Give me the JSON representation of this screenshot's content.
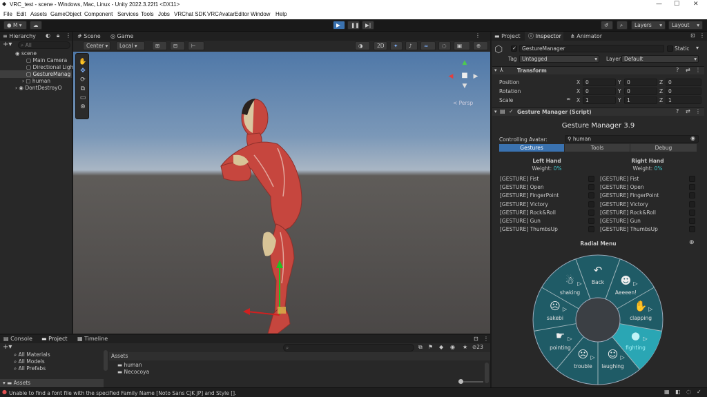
{
  "window": {
    "title": "VRC_test - scene - Windows, Mac, Linux - Unity 2022.3.22f1 <DX11>"
  },
  "menu": [
    "File",
    "Edit",
    "Assets",
    "GameObject",
    "Component",
    "Services",
    "Tools",
    "Jobs",
    "VRChat SDK",
    "VRCAvatarEditor",
    "Window",
    "Help"
  ],
  "toolbar": {
    "account": "M",
    "layers": "Layers",
    "layout": "Layout"
  },
  "hierarchy": {
    "tab": "Hierarchy",
    "search_placeholder": "All",
    "items": [
      "scene",
      "Main Camera",
      "Directional Ligh",
      "GestureManag",
      "human",
      "DontDestroyO"
    ]
  },
  "scene_view": {
    "tabs": [
      "Scene",
      "Game"
    ],
    "pivot": "Center",
    "space": "Local",
    "mode_2d": "2D",
    "persp": "< Persp"
  },
  "bottom": {
    "tabs": [
      "Console",
      "Project",
      "Timeline"
    ],
    "favorites": [
      "All Materials",
      "All Models",
      "All Prefabs"
    ],
    "assets_label": "Assets",
    "asset_root": "Assets",
    "asset_items": [
      "human",
      "Necocoya"
    ],
    "count": "23"
  },
  "status_bar": "Unable to find a font file with the specified Family Name [Noto Sans CJK JP] and Style [].",
  "inspector": {
    "tabs": [
      "Project",
      "Inspector",
      "Animator"
    ],
    "object_name": "GestureManager",
    "static": "Static",
    "tag_label": "Tag",
    "tag": "Untagged",
    "layer_label": "Layer",
    "layer": "Default",
    "transform": {
      "title": "Transform",
      "position": {
        "label": "Position",
        "x": "0",
        "y": "0",
        "z": "0"
      },
      "rotation": {
        "label": "Rotation",
        "x": "0",
        "y": "0",
        "z": "0"
      },
      "scale": {
        "label": "Scale",
        "x": "1",
        "y": "1",
        "z": "1"
      }
    },
    "script_title": "Gesture Manager (Script)",
    "gm": {
      "title": "Gesture Manager 3.9",
      "controlling_label": "Controlling Avatar:",
      "avatar": "human",
      "tabs": [
        "Gestures",
        "Tools",
        "Debug"
      ],
      "left": {
        "title": "Left Hand",
        "weight_label": "Weight:",
        "weight": "0%"
      },
      "right": {
        "title": "Right Hand",
        "weight_label": "Weight:",
        "weight": "0%"
      },
      "gestures": [
        "[GESTURE] Fist",
        "[GESTURE] Open",
        "[GESTURE] FingerPoint",
        "[GESTURE] Victory",
        "[GESTURE] Rock&Roll",
        "[GESTURE] Gun",
        "[GESTURE] ThumbsUp"
      ],
      "radial_title": "Radial Menu",
      "radial_items": [
        "Back",
        "Aeeeen!",
        "clapping",
        "fighting",
        "laughing",
        "trouble",
        "pointing",
        "sakebi",
        "shaking"
      ]
    }
  },
  "colors": {
    "accent": "#3a72b0",
    "radial_bg": "#1f5b66",
    "radial_selected": "#2aa6b4",
    "teal_text": "#3fc3c9"
  }
}
